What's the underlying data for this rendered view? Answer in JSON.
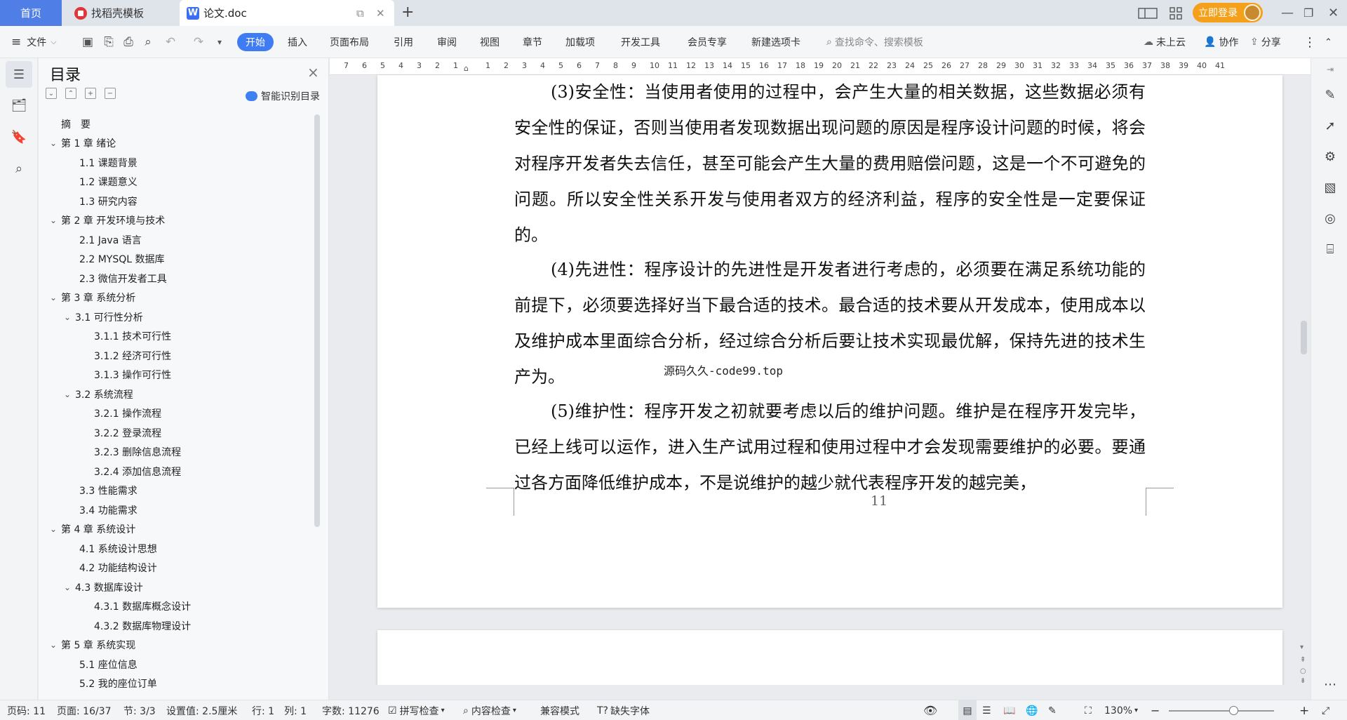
{
  "titlebar": {
    "home_tab": "首页",
    "template_tab": "找稻壳模板",
    "doc_tab": "论文.doc",
    "login_button": "立即登录"
  },
  "ribbon": {
    "file_menu": "文件",
    "tabs": [
      "开始",
      "插入",
      "页面布局",
      "引用",
      "审阅",
      "视图",
      "章节",
      "加载项",
      "开发工具",
      "会员专享",
      "新建选项卡"
    ],
    "search_placeholder": "查找命令、搜索模板",
    "cloud": "未上云",
    "collab": "协作",
    "share": "分享"
  },
  "toc": {
    "title": "目录",
    "ai_button": "智能识别目录",
    "items": [
      {
        "label": "摘　要",
        "level": 1,
        "expandable": false
      },
      {
        "label": "第 1 章  绪论",
        "level": 1,
        "expandable": true
      },
      {
        "label": "1.1  课题背景",
        "level": 2,
        "expandable": false
      },
      {
        "label": "1.2  课题意义",
        "level": 2,
        "expandable": false
      },
      {
        "label": "1.3  研究内容",
        "level": 2,
        "expandable": false
      },
      {
        "label": "第 2 章  开发环境与技术",
        "level": 1,
        "expandable": true
      },
      {
        "label": "2.1 Java 语言",
        "level": 2,
        "expandable": false
      },
      {
        "label": "2.2 MYSQL 数据库",
        "level": 2,
        "expandable": false
      },
      {
        "label": "2.3 微信开发者工具",
        "level": 2,
        "expandable": false
      },
      {
        "label": "第 3 章  系统分析",
        "level": 1,
        "expandable": true
      },
      {
        "label": "3.1  可行性分析",
        "level": 2,
        "expandable": true
      },
      {
        "label": "3.1.1  技术可行性",
        "level": 3,
        "expandable": false
      },
      {
        "label": "3.1.2  经济可行性",
        "level": 3,
        "expandable": false
      },
      {
        "label": "3.1.3  操作可行性",
        "level": 3,
        "expandable": false
      },
      {
        "label": "3.2  系统流程",
        "level": 2,
        "expandable": true
      },
      {
        "label": "3.2.1  操作流程",
        "level": 3,
        "expandable": false
      },
      {
        "label": "3.2.2  登录流程",
        "level": 3,
        "expandable": false
      },
      {
        "label": "3.2.3  删除信息流程",
        "level": 3,
        "expandable": false
      },
      {
        "label": "3.2.4  添加信息流程",
        "level": 3,
        "expandable": false
      },
      {
        "label": "3.3  性能需求",
        "level": 2,
        "expandable": false
      },
      {
        "label": "3.4  功能需求",
        "level": 2,
        "expandable": false
      },
      {
        "label": "第 4 章  系统设计",
        "level": 1,
        "expandable": true
      },
      {
        "label": "4.1  系统设计思想",
        "level": 2,
        "expandable": false
      },
      {
        "label": "4.2  功能结构设计",
        "level": 2,
        "expandable": false
      },
      {
        "label": "4.3  数据库设计",
        "level": 2,
        "expandable": true
      },
      {
        "label": "4.3.1  数据库概念设计",
        "level": 3,
        "expandable": false
      },
      {
        "label": "4.3.2  数据库物理设计",
        "level": 3,
        "expandable": false
      },
      {
        "label": "第 5 章  系统实现",
        "level": 1,
        "expandable": true
      },
      {
        "label": "5.1  座位信息",
        "level": 2,
        "expandable": false
      },
      {
        "label": "5.2  我的座位订单",
        "level": 2,
        "expandable": false
      }
    ]
  },
  "ruler": {
    "left_ticks": [
      "7",
      "6",
      "5",
      "4",
      "3",
      "2",
      "1"
    ],
    "right_ticks": [
      "1",
      "2",
      "3",
      "4",
      "5",
      "6",
      "7",
      "8",
      "9",
      "10",
      "11",
      "12",
      "13",
      "14",
      "15",
      "16",
      "17",
      "18",
      "19",
      "20",
      "21",
      "22",
      "23",
      "24",
      "25",
      "26",
      "27",
      "28",
      "29",
      "30",
      "31",
      "32",
      "33",
      "34",
      "35",
      "36",
      "37",
      "38",
      "39",
      "40",
      "41"
    ]
  },
  "document": {
    "paragraphs": [
      "(3)安全性：当使用者使用的过程中，会产生大量的相关数据，这些数据必须有安全性的保证，否则当使用者发现数据出现问题的原因是程序设计问题的时候，将会对程序开发者失去信任，甚至可能会产生大量的费用赔偿问题，这是一个不可避免的问题。所以安全性关系开发与使用者双方的经济利益，程序的安全性是一定要保证的。",
      "(4)先进性：程序设计的先进性是开发者进行考虑的，必须要在满足系统功能的前提下，必须要选择好当下最合适的技术。最合适的技术要从开发成本，使用成本以及维护成本里面综合分析，经过综合分析后要让技术实现最优解，保持先进的技术生产为。",
      "(5)维护性：程序开发之初就要考虑以后的维护问题。维护是在程序开发完毕，已经上线可以运作，进入生产试用过程和使用过程中才会发现需要维护的必要。要通过各方面降低维护成本，不是说维护的越少就代表程序开发的越完美，"
    ],
    "watermark": "源码久久-code99.top",
    "page_number": "11"
  },
  "statusbar": {
    "page_code": "页码: 11",
    "page": "页面: 16/37",
    "section": "节: 3/3",
    "setting": "设置值: 2.5厘米",
    "row": "行: 1",
    "col": "列: 1",
    "word_count": "字数: 11276",
    "spell_check": "拼写检查",
    "content_check": "内容检查",
    "compat_mode": "兼容模式",
    "missing_font": "缺失字体",
    "zoom": "130%"
  }
}
